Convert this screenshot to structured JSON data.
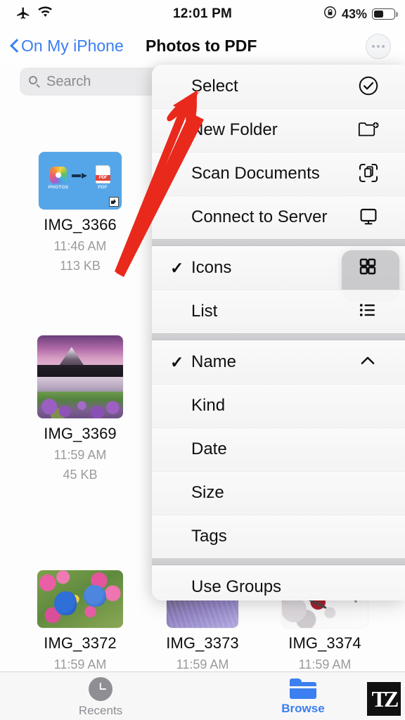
{
  "status_bar": {
    "airplane_icon": "airplane-mode-icon",
    "wifi_icon": "wifi-icon",
    "time": "12:01 PM",
    "rotation_lock_icon": "rotation-lock-icon",
    "battery_percent": "43%",
    "battery_level": 43
  },
  "nav_bar": {
    "back_label": "On My iPhone",
    "title": "Photos to PDF",
    "more_icon": "ellipsis-circle-icon"
  },
  "search": {
    "placeholder": "Search",
    "value": "",
    "icon": "search-icon"
  },
  "files": [
    {
      "name": "IMG_3366",
      "time": "11:46 AM",
      "size": "113 KB",
      "thumb": "photos-to-pdf-shortcut",
      "thumb_labels": {
        "left": "PHOTOS",
        "right": "PDF"
      }
    },
    {
      "name": "IMG_3369",
      "time": "11:59 AM",
      "size": "45 KB",
      "thumb": "mountain-lake-photo"
    },
    {
      "name": "IMG_3372",
      "time": "11:59 AM",
      "size": "",
      "thumb": "bluebirds-blossoms-photo"
    },
    {
      "name": "IMG_3373",
      "time": "11:59 AM",
      "size": "",
      "thumb": "lavender-field-photo"
    },
    {
      "name": "IMG_3374",
      "time": "11:59 AM",
      "size": "",
      "thumb": "white-blossom-photo"
    }
  ],
  "context_menu": {
    "groups": [
      {
        "items": [
          {
            "label": "Select",
            "icon": "checkmark-circle-icon",
            "checked": false
          },
          {
            "label": "New Folder",
            "icon": "folder-plus-icon",
            "checked": false
          },
          {
            "label": "Scan Documents",
            "icon": "scan-documents-icon",
            "checked": false
          },
          {
            "label": "Connect to Server",
            "icon": "display-icon",
            "checked": false
          }
        ]
      },
      {
        "items": [
          {
            "label": "Icons",
            "icon": "grid-icon",
            "checked": true,
            "highlighted": true
          },
          {
            "label": "List",
            "icon": "list-icon",
            "checked": false
          }
        ]
      },
      {
        "items": [
          {
            "label": "Name",
            "icon": "chevron-up-icon",
            "checked": true
          },
          {
            "label": "Kind",
            "icon": "",
            "checked": false
          },
          {
            "label": "Date",
            "icon": "",
            "checked": false
          },
          {
            "label": "Size",
            "icon": "",
            "checked": false
          },
          {
            "label": "Tags",
            "icon": "",
            "checked": false
          }
        ]
      },
      {
        "items": [
          {
            "label": "Use Groups",
            "icon": "",
            "checked": false
          }
        ]
      }
    ],
    "checkmark_glyph": "✓"
  },
  "annotation": {
    "arrow_color": "#e8291c",
    "points_to": "Select"
  },
  "tab_bar": {
    "tabs": [
      {
        "label": "Recents",
        "icon": "clock-icon",
        "active": false
      },
      {
        "label": "Browse",
        "icon": "folder-icon",
        "active": true
      }
    ],
    "active_color": "#3b7ff0",
    "inactive_color": "#8e8e93"
  },
  "watermark": {
    "text": "TZ"
  }
}
